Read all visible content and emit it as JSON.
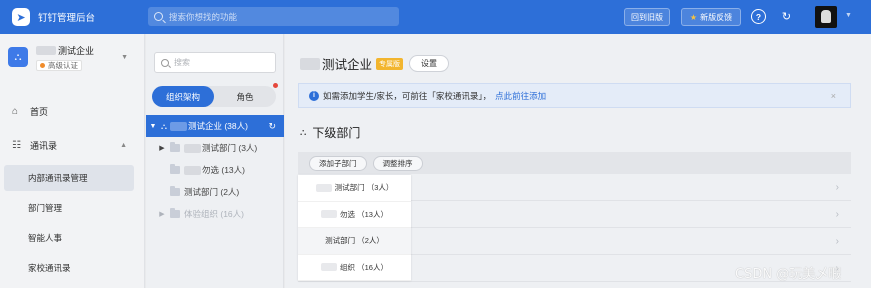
{
  "topbar": {
    "app_title": "钉钉管理后台",
    "search_placeholder": "搜索你想找的功能",
    "back_to_old_label": "回到旧版",
    "feedback_label": "新版反馈",
    "accent": "#2d6fd8"
  },
  "sidebar": {
    "corp_name": "测试企业",
    "auth_label": "高级认证",
    "items": [
      {
        "label": "首页",
        "icon": "home-icon"
      },
      {
        "label": "通讯录",
        "icon": "contacts-icon"
      },
      {
        "label": "内部通讯录管理"
      },
      {
        "label": "部门管理"
      },
      {
        "label": "智能人事"
      },
      {
        "label": "家校通讯录"
      }
    ]
  },
  "org_panel": {
    "search_placeholder": "搜索",
    "tabs": [
      {
        "label": "组织架构"
      },
      {
        "label": "角色"
      }
    ],
    "tree": [
      {
        "label": "测试企业 (38人)"
      },
      {
        "label": "测试部门 (3人)"
      },
      {
        "label": "勿选 (13人)"
      },
      {
        "label": "测试部门 (2人)"
      },
      {
        "label": "体验组织 (16人)"
      }
    ]
  },
  "main": {
    "title": "测试企业",
    "exclusive_badge": "专属版",
    "settings_label": "设置",
    "notice_text": "如需添加学生/家长，可前往「家校通讯录」，",
    "notice_link": "点此前往添加",
    "notice_close": "×",
    "section_title": "下级部门",
    "add_sub_dept_label": "添加子部门",
    "adjust_order_label": "调整排序",
    "departments": [
      {
        "label": "测试部门 （3人）"
      },
      {
        "label": "勿选 （13人）"
      },
      {
        "label": "测试部门 （2人）"
      },
      {
        "label": "组织 （16人）"
      }
    ]
  },
  "watermark": "CSDN @玩美乄暇"
}
